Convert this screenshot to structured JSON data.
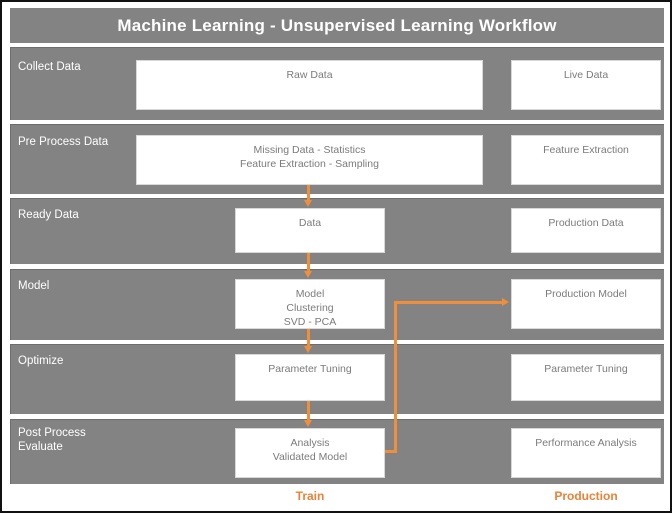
{
  "header": {
    "title": "Machine Learning - Unsupervised Learning Workflow"
  },
  "colors": {
    "band": "#838383",
    "accent": "#ef8f3c",
    "box_text": "#7b7b7b",
    "label_text": "#ffffff",
    "page_bg": "#ffffff",
    "border": "#111111"
  },
  "rows": [
    {
      "label": "Collect Data",
      "train_box": "Raw  Data",
      "production_box": "Live Data"
    },
    {
      "label": "Pre Process Data",
      "train_box": "Missing Data - Statistics\nFeature Extraction - Sampling",
      "production_box": "Feature Extraction"
    },
    {
      "label": "Ready Data",
      "train_box": "Data",
      "production_box": "Production Data"
    },
    {
      "label": "Model",
      "train_box": "Model\nClustering\nSVD - PCA",
      "production_box": "Production Model"
    },
    {
      "label": "Optimize",
      "train_box": "Parameter Tuning",
      "production_box": "Parameter Tuning"
    },
    {
      "label": "Post Process\nEvaluate",
      "train_box": "Analysis\nValidated Model",
      "production_box": "Performance Analysis"
    }
  ],
  "footer": {
    "train_label": "Train",
    "production_label": "Production"
  }
}
